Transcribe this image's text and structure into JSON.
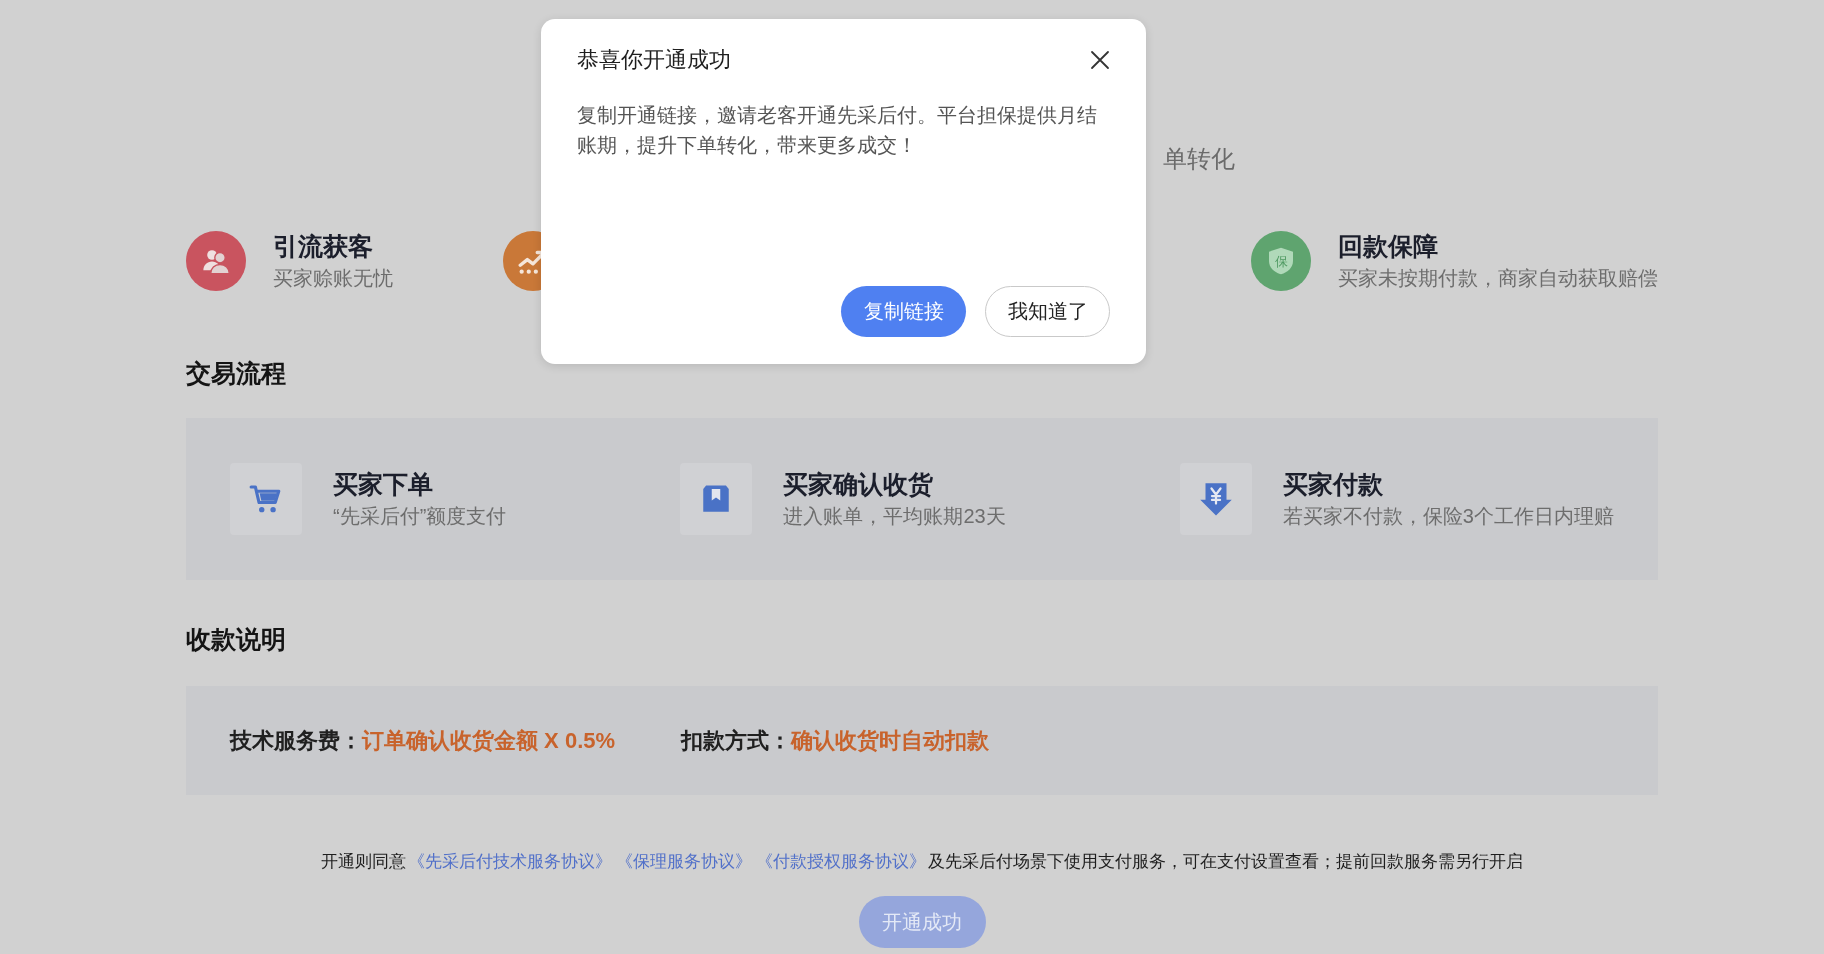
{
  "background_page": {
    "subtitle_fragment": "单转化",
    "features": [
      {
        "kind": "people",
        "title": "引流获客",
        "subtitle": "买家赊账无忧",
        "color": "#c9545f"
      },
      {
        "kind": "trend",
        "color": "#c97838"
      },
      {
        "kind": "shield",
        "icon_text": "保",
        "title": "回款保障",
        "subtitle": "买家未按期付款，商家自动获取赔偿",
        "color": "#5fa46f"
      }
    ],
    "process": {
      "title": "交易流程",
      "steps": [
        {
          "kind": "cart",
          "title": "买家下单",
          "description": "“先采后付”额度支付"
        },
        {
          "kind": "package",
          "title": "买家确认收货",
          "description": "进入账单，平均账期23天"
        },
        {
          "kind": "yuan",
          "title": "买家付款",
          "description": "若买家不付款，保险3个工作日内理赔"
        }
      ]
    },
    "payment_info": {
      "title": "收款说明",
      "items": [
        {
          "label": "技术服务费：",
          "value": "订单确认收货金额 X 0.5%"
        },
        {
          "label": "扣款方式：",
          "value": "确认收货时自动扣款"
        }
      ]
    },
    "agreement": {
      "prefix": "开通则同意",
      "links": [
        "《先采后付技术服务协议》",
        "《保理服务协议》",
        "《付款授权服务协议》"
      ],
      "suffix": "及先采后付场景下使用支付服务，可在支付设置查看；提前回款服务需另行开启"
    },
    "submit_button": {
      "label": "开通成功",
      "disabled": true
    }
  },
  "dialog": {
    "title": "恭喜你开通成功",
    "message": "复制开通链接，邀请老客开通先采后付。平台担保提供月结账期，提升下单转化，带来更多成交！",
    "buttons": [
      {
        "kind": "primary",
        "label": "复制链接"
      },
      {
        "kind": "secondary",
        "label": "我知道了"
      }
    ]
  }
}
